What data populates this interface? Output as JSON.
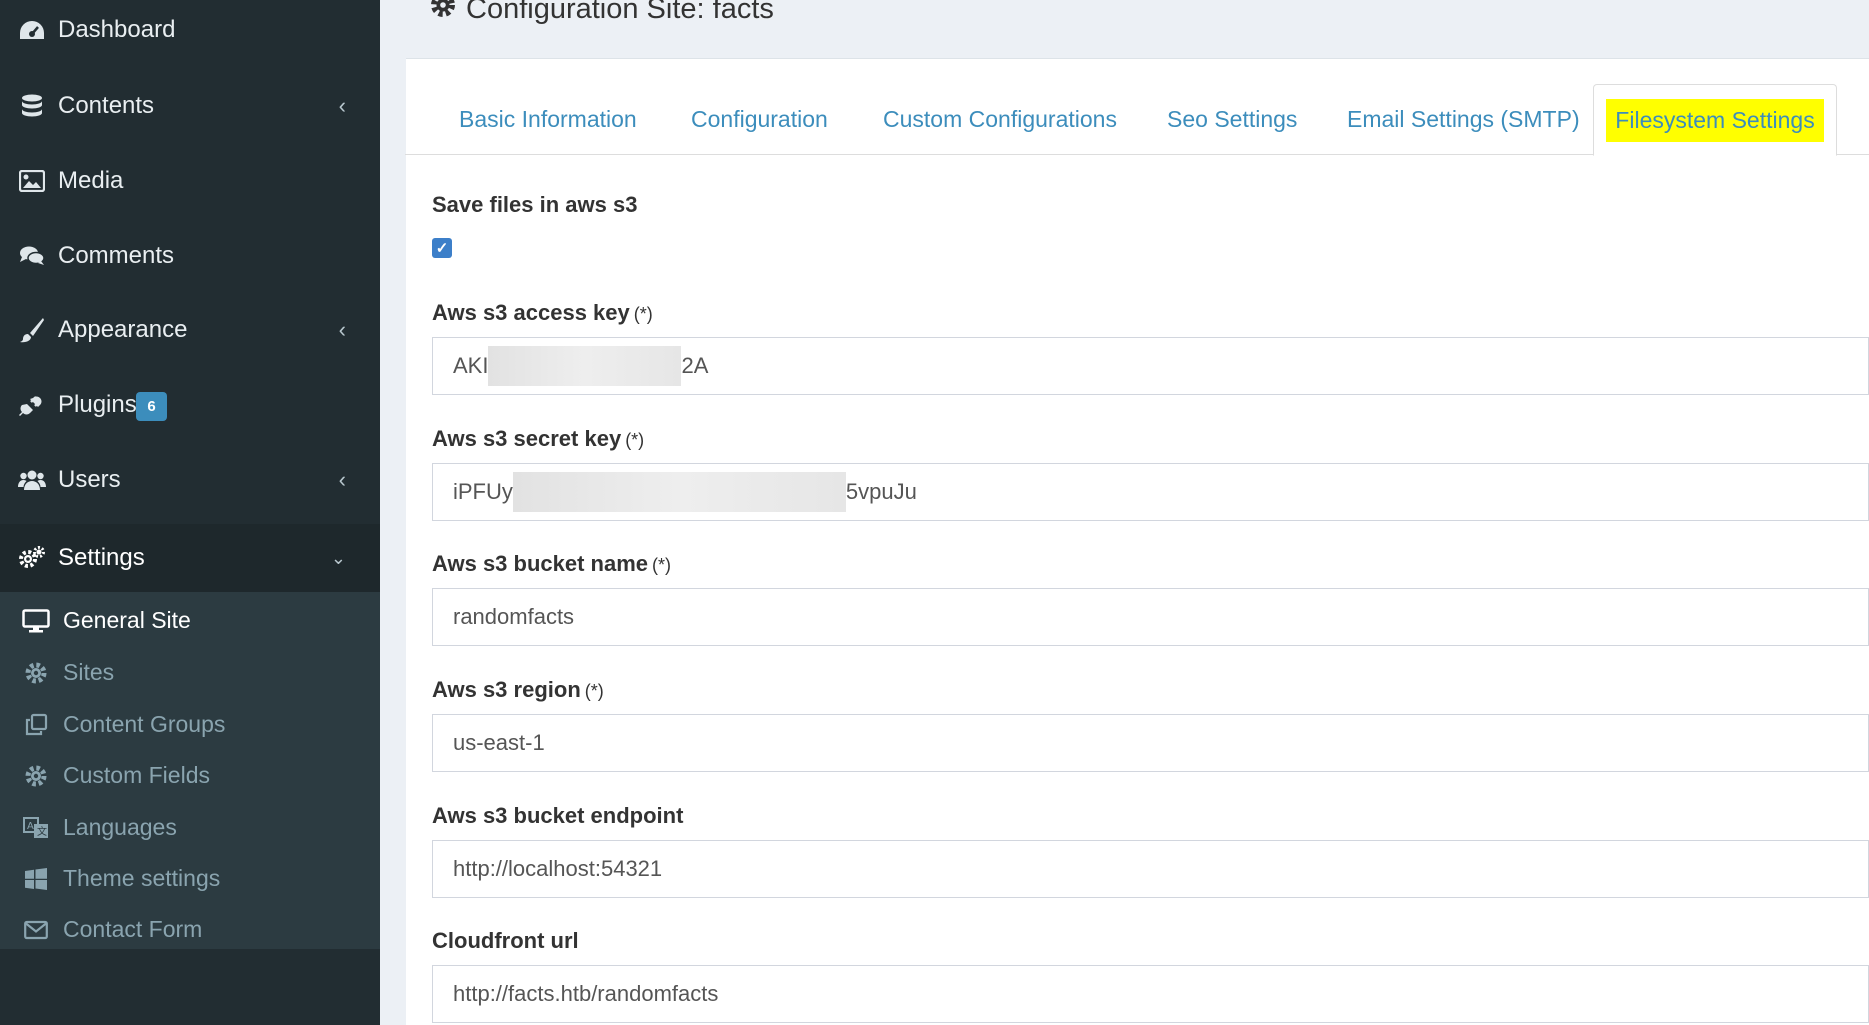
{
  "sidebar": {
    "items": [
      {
        "label": "Dashboard",
        "icon": "dashboard-icon"
      },
      {
        "label": "Contents",
        "icon": "database-icon"
      },
      {
        "label": "Media",
        "icon": "image-icon"
      },
      {
        "label": "Comments",
        "icon": "comments-icon"
      },
      {
        "label": "Appearance",
        "icon": "paintbrush-icon"
      },
      {
        "label": "Plugins",
        "icon": "plug-icon",
        "badge": "6"
      },
      {
        "label": "Users",
        "icon": "users-icon"
      },
      {
        "label": "Settings",
        "icon": "gears-icon"
      }
    ],
    "submenu": [
      {
        "label": "General Site",
        "icon": "desktop-icon"
      },
      {
        "label": "Sites",
        "icon": "gear-icon"
      },
      {
        "label": "Content Groups",
        "icon": "clone-icon"
      },
      {
        "label": "Custom Fields",
        "icon": "gear-icon"
      },
      {
        "label": "Languages",
        "icon": "language-icon"
      },
      {
        "label": "Theme settings",
        "icon": "windows-icon"
      },
      {
        "label": "Contact Form",
        "icon": "envelope-icon"
      }
    ]
  },
  "header": {
    "title": "Configuration Site: facts"
  },
  "tabs": [
    {
      "label": "Basic Information"
    },
    {
      "label": "Configuration"
    },
    {
      "label": "Custom Configurations"
    },
    {
      "label": "Seo Settings"
    },
    {
      "label": "Email Settings (SMTP)"
    },
    {
      "label": "Filesystem Settings"
    }
  ],
  "form": {
    "save_s3_label": "Save files in aws s3",
    "save_s3_checked": true,
    "required_mark": "(*)",
    "access_key": {
      "label": "Aws s3 access key",
      "prefix": "AKI",
      "suffix": "2A"
    },
    "secret_key": {
      "label": "Aws s3 secret key",
      "prefix": "iPFUy",
      "suffix": "5vpuJu"
    },
    "bucket_name": {
      "label": "Aws s3 bucket name",
      "value": "randomfacts"
    },
    "region": {
      "label": "Aws s3 region",
      "value": "us-east-1"
    },
    "endpoint": {
      "label": "Aws s3 bucket endpoint",
      "value": "http://localhost:54321"
    },
    "cloudfront": {
      "label": "Cloudfront url",
      "value": "http://facts.htb/randomfacts"
    }
  },
  "colors": {
    "sidebar_bg": "#222d32",
    "submenu_bg": "#2c3b41",
    "link": "#3c8dbc",
    "highlight": "#ffff00"
  }
}
